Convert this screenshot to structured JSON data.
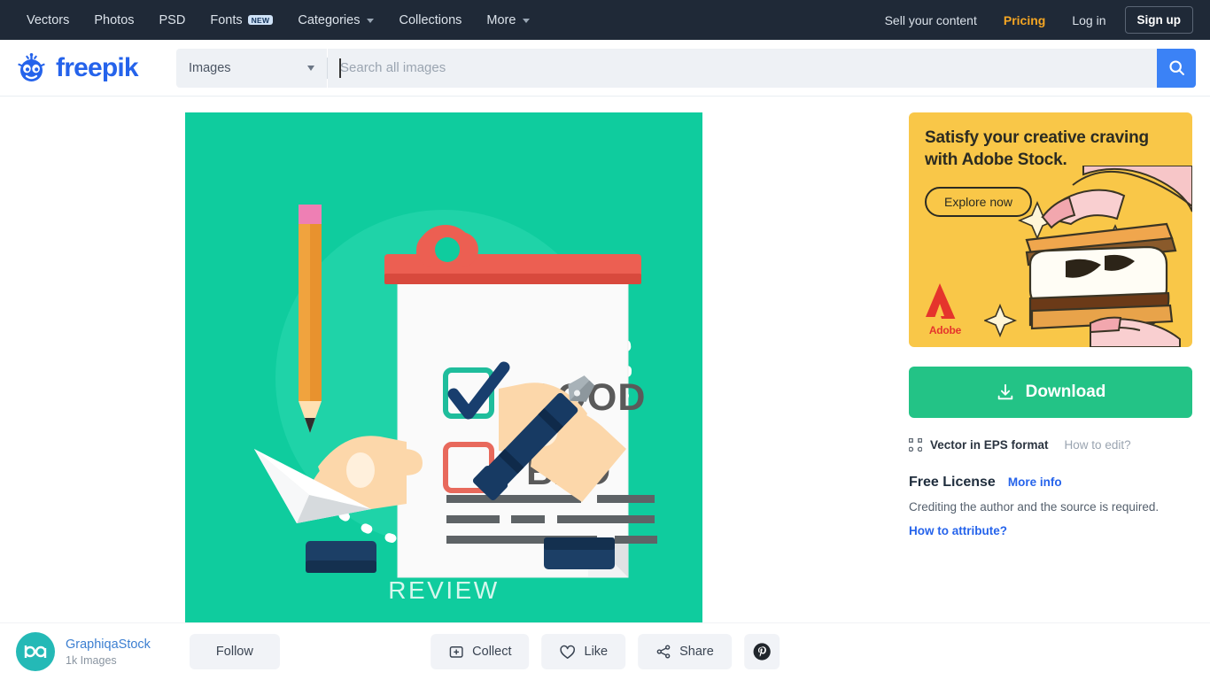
{
  "topnav": {
    "items": [
      {
        "label": "Vectors",
        "badge": null,
        "caret": false
      },
      {
        "label": "Photos",
        "badge": null,
        "caret": false
      },
      {
        "label": "PSD",
        "badge": null,
        "caret": false
      },
      {
        "label": "Fonts",
        "badge": "NEW",
        "caret": false
      },
      {
        "label": "Categories",
        "badge": null,
        "caret": true
      },
      {
        "label": "Collections",
        "badge": null,
        "caret": false
      },
      {
        "label": "More",
        "badge": null,
        "caret": true
      }
    ],
    "sell": "Sell your content",
    "pricing": "Pricing",
    "login": "Log in",
    "signup": "Sign up",
    "bg_color": "#1f2937",
    "pricing_color": "#f5a623"
  },
  "header": {
    "logo_text": "freepik",
    "logo_color": "#2563eb",
    "logo_icon": "freepik-robot-icon"
  },
  "search": {
    "category": "Images",
    "placeholder": "Search all images",
    "value": "",
    "button_icon": "search-icon",
    "button_color": "#3b82f6"
  },
  "preview": {
    "alt": "Review clipboard flat illustration",
    "bg_color": "#0fcc9e",
    "caption": "REVIEW",
    "checkbox_good": "GOOD",
    "checkbox_bad": "BAD"
  },
  "ad": {
    "title": "Satisfy your creative craving with Adobe Stock.",
    "cta": "Explore now",
    "brand": "Adobe",
    "bg_color": "#f9c748",
    "brand_color": "#e5342c"
  },
  "download": {
    "label": "Download",
    "icon": "download-icon",
    "color": "#23c386",
    "format_icon": "vector-nodes-icon",
    "format_label": "Vector in EPS format",
    "how_to_edit": "How to edit?",
    "license_title": "Free License",
    "license_more": "More info",
    "license_desc": "Crediting the author and the source is required.",
    "how_to_attribute": "How to attribute?"
  },
  "author": {
    "avatar_text": "ba",
    "avatar_color": "#24b9b6",
    "name": "GraphiqaStock",
    "count": "1k Images",
    "follow": "Follow"
  },
  "actions": [
    {
      "label": "Collect",
      "icon": "collect-folder-icon"
    },
    {
      "label": "Like",
      "icon": "heart-icon"
    },
    {
      "label": "Share",
      "icon": "share-nodes-icon"
    }
  ],
  "pinterest": {
    "label": "",
    "icon": "pinterest-icon"
  }
}
